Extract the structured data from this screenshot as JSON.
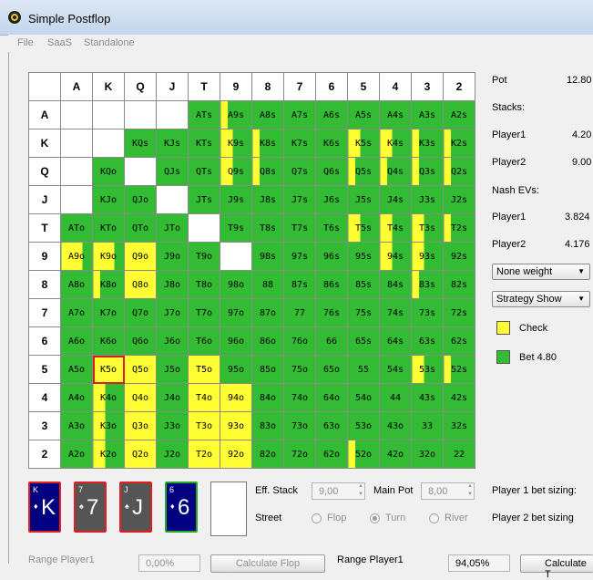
{
  "window": {
    "title": "Simple Postflop"
  },
  "menu": [
    "File",
    "SaaS",
    "Standalone"
  ],
  "grid": {
    "columns": [
      "A",
      "K",
      "Q",
      "J",
      "T",
      "9",
      "8",
      "7",
      "6",
      "5",
      "4",
      "3",
      "2"
    ],
    "rows": [
      {
        "label": "A",
        "cells": [
          [
            "",
            "w"
          ],
          [
            "",
            "w"
          ],
          [
            "",
            "w"
          ],
          [
            "",
            "w"
          ],
          [
            "ATs",
            "g"
          ],
          [
            "A9s",
            "ml"
          ],
          [
            "A8s",
            "g"
          ],
          [
            "A7s",
            "g"
          ],
          [
            "A6s",
            "g"
          ],
          [
            "A5s",
            "g"
          ],
          [
            "A4s",
            "g"
          ],
          [
            "A3s",
            "g"
          ],
          [
            "A2s",
            "g"
          ]
        ]
      },
      {
        "label": "K",
        "cells": [
          [
            "",
            "w"
          ],
          [
            "",
            "w"
          ],
          [
            "KQs",
            "g"
          ],
          [
            "KJs",
            "g"
          ],
          [
            "KTs",
            "g"
          ],
          [
            "K9s",
            "mh"
          ],
          [
            "K8s",
            "ml"
          ],
          [
            "K7s",
            "g"
          ],
          [
            "K6s",
            "g"
          ],
          [
            "K5s",
            "mh"
          ],
          [
            "K4s",
            "mh"
          ],
          [
            "K3s",
            "ml"
          ],
          [
            "K2s",
            "ml"
          ]
        ]
      },
      {
        "label": "Q",
        "cells": [
          [
            "",
            "w"
          ],
          [
            "KQo",
            "g"
          ],
          [
            "",
            "w"
          ],
          [
            "QJs",
            "g"
          ],
          [
            "QTs",
            "g"
          ],
          [
            "Q9s",
            "mh"
          ],
          [
            "Q8s",
            "ml"
          ],
          [
            "Q7s",
            "g"
          ],
          [
            "Q6s",
            "g"
          ],
          [
            "Q5s",
            "ml"
          ],
          [
            "Q4s",
            "ml"
          ],
          [
            "Q3s",
            "ml"
          ],
          [
            "Q2s",
            "ml"
          ]
        ]
      },
      {
        "label": "J",
        "cells": [
          [
            "",
            "w"
          ],
          [
            "KJo",
            "g"
          ],
          [
            "QJo",
            "g"
          ],
          [
            "",
            "w"
          ],
          [
            "JTs",
            "g"
          ],
          [
            "J9s",
            "g"
          ],
          [
            "J8s",
            "g"
          ],
          [
            "J7s",
            "g"
          ],
          [
            "J6s",
            "g"
          ],
          [
            "J5s",
            "g"
          ],
          [
            "J4s",
            "g"
          ],
          [
            "J3s",
            "g"
          ],
          [
            "J2s",
            "g"
          ]
        ]
      },
      {
        "label": "T",
        "cells": [
          [
            "ATo",
            "g"
          ],
          [
            "KTo",
            "g"
          ],
          [
            "QTo",
            "g"
          ],
          [
            "JTo",
            "g"
          ],
          [
            "",
            "w"
          ],
          [
            "T9s",
            "g"
          ],
          [
            "T8s",
            "g"
          ],
          [
            "T7s",
            "g"
          ],
          [
            "T6s",
            "g"
          ],
          [
            "T5s",
            "mh"
          ],
          [
            "T4s",
            "mh"
          ],
          [
            "T3s",
            "mh"
          ],
          [
            "T2s",
            "ml"
          ]
        ]
      },
      {
        "label": "9",
        "cells": [
          [
            "A9o",
            "yr"
          ],
          [
            "K9o",
            "yr"
          ],
          [
            "Q9o",
            "y"
          ],
          [
            "J9o",
            "g"
          ],
          [
            "T9o",
            "g"
          ],
          [
            "",
            "w"
          ],
          [
            "98s",
            "g"
          ],
          [
            "97s",
            "g"
          ],
          [
            "96s",
            "g"
          ],
          [
            "95s",
            "g"
          ],
          [
            "94s",
            "mh"
          ],
          [
            "93s",
            "mh"
          ],
          [
            "92s",
            "g"
          ]
        ]
      },
      {
        "label": "8",
        "cells": [
          [
            "A8o",
            "g"
          ],
          [
            "K8o",
            "ml"
          ],
          [
            "Q8o",
            "y"
          ],
          [
            "J8o",
            "g"
          ],
          [
            "T8o",
            "g"
          ],
          [
            "98o",
            "g"
          ],
          [
            "88",
            "g"
          ],
          [
            "87s",
            "g"
          ],
          [
            "86s",
            "g"
          ],
          [
            "85s",
            "g"
          ],
          [
            "84s",
            "g"
          ],
          [
            "83s",
            "ml"
          ],
          [
            "82s",
            "g"
          ]
        ]
      },
      {
        "label": "7",
        "cells": [
          [
            "A7o",
            "g"
          ],
          [
            "K7o",
            "g"
          ],
          [
            "Q7o",
            "g"
          ],
          [
            "J7o",
            "g"
          ],
          [
            "T7o",
            "g"
          ],
          [
            "97o",
            "g"
          ],
          [
            "87o",
            "g"
          ],
          [
            "77",
            "g"
          ],
          [
            "76s",
            "g"
          ],
          [
            "75s",
            "g"
          ],
          [
            "74s",
            "g"
          ],
          [
            "73s",
            "g"
          ],
          [
            "72s",
            "g"
          ]
        ]
      },
      {
        "label": "6",
        "cells": [
          [
            "A6o",
            "g"
          ],
          [
            "K6o",
            "g"
          ],
          [
            "Q6o",
            "g"
          ],
          [
            "J6o",
            "g"
          ],
          [
            "T6o",
            "g"
          ],
          [
            "96o",
            "g"
          ],
          [
            "86o",
            "g"
          ],
          [
            "76o",
            "g"
          ],
          [
            "66",
            "g"
          ],
          [
            "65s",
            "g"
          ],
          [
            "64s",
            "g"
          ],
          [
            "63s",
            "g"
          ],
          [
            "62s",
            "g"
          ]
        ]
      },
      {
        "label": "5",
        "cells": [
          [
            "A5o",
            "g"
          ],
          [
            "K5o",
            "y sel"
          ],
          [
            "Q5o",
            "y"
          ],
          [
            "J5o",
            "g"
          ],
          [
            "T5o",
            "y"
          ],
          [
            "95o",
            "g"
          ],
          [
            "85o",
            "g"
          ],
          [
            "75o",
            "g"
          ],
          [
            "65o",
            "g"
          ],
          [
            "55",
            "g"
          ],
          [
            "54s",
            "g"
          ],
          [
            "53s",
            "mh"
          ],
          [
            "52s",
            "ml"
          ]
        ]
      },
      {
        "label": "4",
        "cells": [
          [
            "A4o",
            "g"
          ],
          [
            "K4o",
            "mh"
          ],
          [
            "Q4o",
            "y"
          ],
          [
            "J4o",
            "g"
          ],
          [
            "T4o",
            "y"
          ],
          [
            "94o",
            "y"
          ],
          [
            "84o",
            "g"
          ],
          [
            "74o",
            "g"
          ],
          [
            "64o",
            "g"
          ],
          [
            "54o",
            "g"
          ],
          [
            "44",
            "g"
          ],
          [
            "43s",
            "g"
          ],
          [
            "42s",
            "g"
          ]
        ]
      },
      {
        "label": "3",
        "cells": [
          [
            "A3o",
            "g"
          ],
          [
            "K3o",
            "mh"
          ],
          [
            "Q3o",
            "y"
          ],
          [
            "J3o",
            "g"
          ],
          [
            "T3o",
            "y"
          ],
          [
            "93o",
            "y"
          ],
          [
            "83o",
            "g"
          ],
          [
            "73o",
            "g"
          ],
          [
            "63o",
            "g"
          ],
          [
            "53o",
            "g"
          ],
          [
            "43o",
            "g"
          ],
          [
            "33",
            "g"
          ],
          [
            "32s",
            "g"
          ]
        ]
      },
      {
        "label": "2",
        "cells": [
          [
            "A2o",
            "g"
          ],
          [
            "K2o",
            "mh"
          ],
          [
            "Q2o",
            "y"
          ],
          [
            "J2o",
            "g"
          ],
          [
            "T2o",
            "y"
          ],
          [
            "92o",
            "y"
          ],
          [
            "82o",
            "g"
          ],
          [
            "72o",
            "g"
          ],
          [
            "62o",
            "g"
          ],
          [
            "52o",
            "ml"
          ],
          [
            "42o",
            "g"
          ],
          [
            "32o",
            "g"
          ],
          [
            "22",
            "g"
          ]
        ]
      }
    ]
  },
  "info": {
    "pot_label": "Pot",
    "pot_value": "12.80",
    "stacks_label": "Stacks:",
    "p1_label": "Player1",
    "p1_stack": "4.20",
    "p2_label": "Player2",
    "p2_stack": "9.00",
    "ev_label": "Nash EVs:",
    "p1_ev_label": "Player1",
    "p1_ev": "3.824",
    "p2_ev_label": "Player2",
    "p2_ev": "4.176"
  },
  "weight_select": "None weight",
  "strategy_select": "Strategy Show",
  "legend": [
    {
      "label": "Check",
      "color": "#ffff33"
    },
    {
      "label": "Bet 4.80",
      "color": "#33bb33"
    }
  ],
  "board": [
    {
      "rank": "K",
      "suit": "♦",
      "bg": "#000080",
      "border": "#e02020"
    },
    {
      "rank": "7",
      "suit": "♠",
      "bg": "#555555",
      "border": "#e02020"
    },
    {
      "rank": "J",
      "suit": "♠",
      "bg": "#555555",
      "border": "#e02020"
    },
    {
      "rank": "6",
      "suit": "♦",
      "bg": "#000080",
      "border": "#22aa22"
    }
  ],
  "controls": {
    "eff_stack_label": "Eff. Stack",
    "eff_stack_value": "9,00",
    "main_pot_label": "Main Pot",
    "main_pot_value": "8,00",
    "street_label": "Street",
    "streets": [
      "Flop",
      "Turn",
      "River"
    ],
    "selected_street": "Turn",
    "p1_bet_sizing": "Player 1 bet sizing:",
    "p2_bet_sizing": "Player 2 bet sizing"
  },
  "bottom": {
    "range_p1_left": "Range Player1",
    "range_p1_left_value": "0,00%",
    "calc_flop": "Calculate Flop",
    "range_p1_right": "Range Player1",
    "range_p1_right_value": "94,05%",
    "calc_turn": "Calculate T"
  }
}
